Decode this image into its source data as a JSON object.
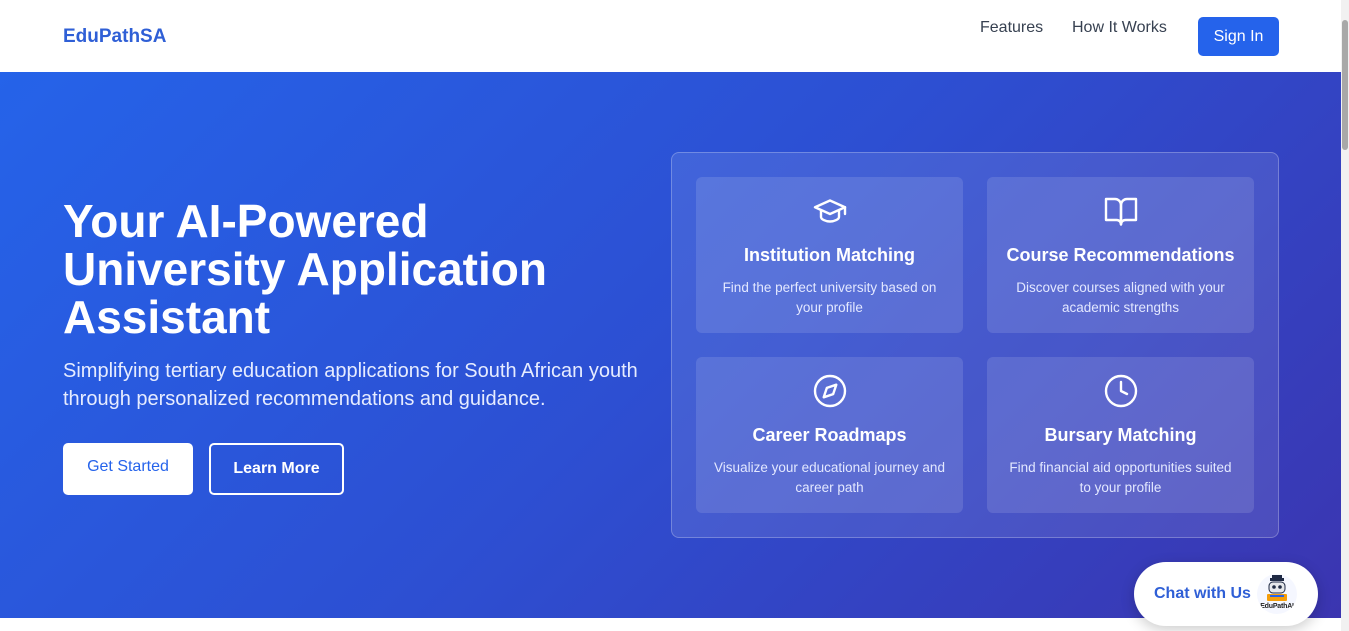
{
  "nav": {
    "brand": "EduPathSA",
    "links": [
      "Features",
      "How It Works"
    ],
    "signin": "Sign In"
  },
  "hero": {
    "title": "Your AI-Powered University Application Assistant",
    "subtitle": "Simplifying tertiary education applications for South African youth through personalized recommendations and guidance.",
    "primary_button": "Get Started",
    "secondary_button": "Learn More"
  },
  "features": [
    {
      "icon": "graduation-cap-icon",
      "title": "Institution Matching",
      "description": "Find the perfect university based on your profile"
    },
    {
      "icon": "open-book-icon",
      "title": "Course Recommendations",
      "description": "Discover courses aligned with your academic strengths"
    },
    {
      "icon": "compass-icon",
      "title": "Career Roadmaps",
      "description": "Visualize your educational journey and career path"
    },
    {
      "icon": "clock-icon",
      "title": "Bursary Matching",
      "description": "Find financial aid opportunities suited to your profile"
    }
  ],
  "chat": {
    "label": "Chat with Us",
    "avatar_text": "EduPathAI"
  },
  "colors": {
    "accent": "#2563eb",
    "hero_gradient_start": "#2563e9",
    "hero_gradient_end": "#3b35b0"
  }
}
